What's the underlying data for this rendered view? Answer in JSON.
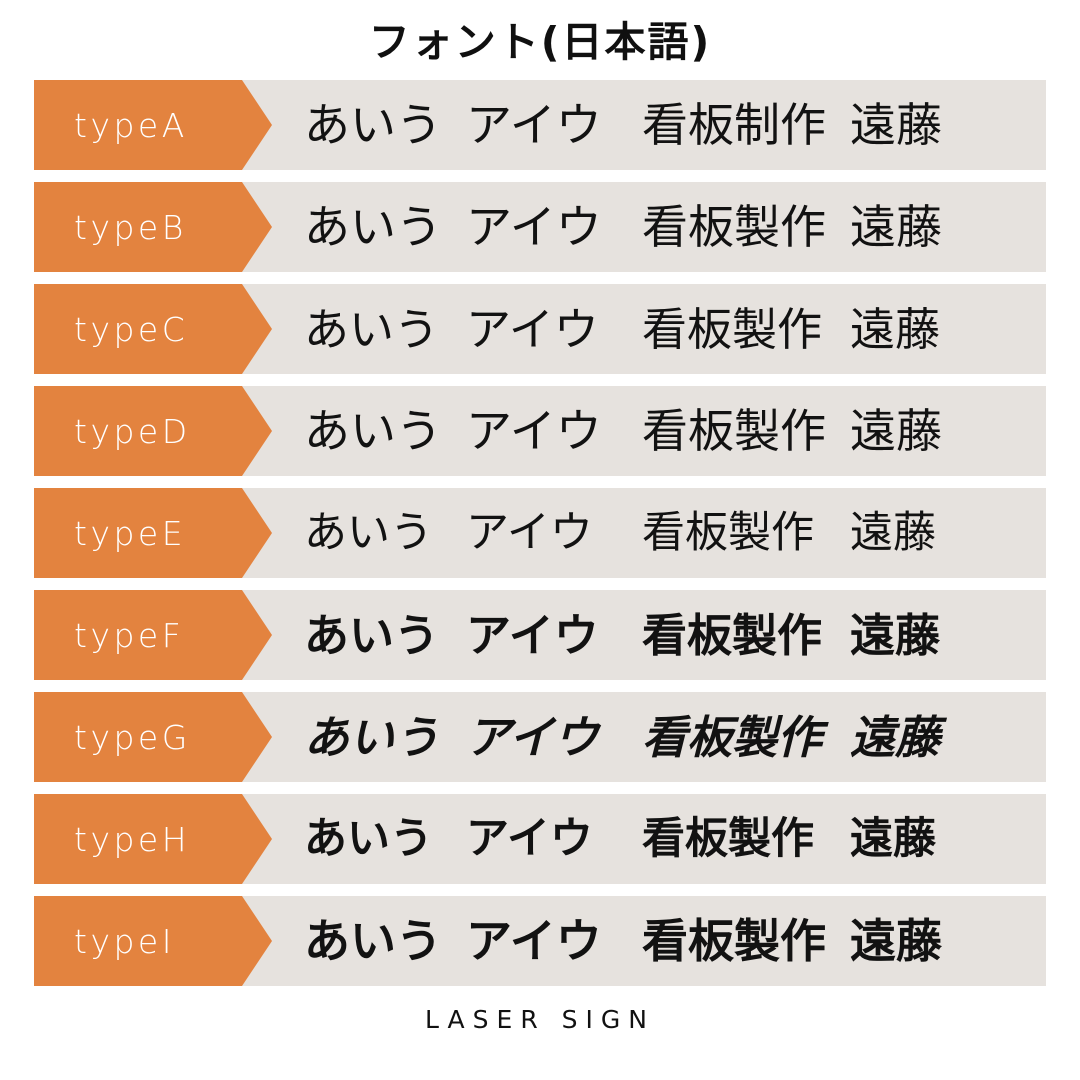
{
  "page": {
    "title": "フォント(日本語)",
    "footer": "LASER SIGN",
    "background_color": "#FFFFFF",
    "accent_color": "#E3833F",
    "row_background_color": "#E6E2DE",
    "text_color": "#121212",
    "tag_label_color": "#FFFFFF"
  },
  "columns": {
    "hiragana": "あいう",
    "katakana": "アイウ",
    "kanji": "看板製作",
    "name": "遠藤"
  },
  "rows": [
    {
      "label": "typeA",
      "hiragana": "あいう",
      "katakana": "アイウ",
      "kanji": "看板制作",
      "name": "遠藤"
    },
    {
      "label": "typeB",
      "hiragana": "あいう",
      "katakana": "アイウ",
      "kanji": "看板製作",
      "name": "遠藤"
    },
    {
      "label": "typeC",
      "hiragana": "あいう",
      "katakana": "アイウ",
      "kanji": "看板製作",
      "name": "遠藤"
    },
    {
      "label": "typeD",
      "hiragana": "あいう",
      "katakana": "アイウ",
      "kanji": "看板製作",
      "name": "遠藤"
    },
    {
      "label": "typeE",
      "hiragana": "あいう",
      "katakana": "アイウ",
      "kanji": "看板製作",
      "name": "遠藤"
    },
    {
      "label": "typeF",
      "hiragana": "あいう",
      "katakana": "アイウ",
      "kanji": "看板製作",
      "name": "遠藤"
    },
    {
      "label": "typeG",
      "hiragana": "あいう",
      "katakana": "アイウ",
      "kanji": "看板製作",
      "name": "遠藤"
    },
    {
      "label": "typeH",
      "hiragana": "あいう",
      "katakana": "アイウ",
      "kanji": "看板製作",
      "name": "遠藤"
    },
    {
      "label": "typeI",
      "hiragana": "あいう",
      "katakana": "アイウ",
      "kanji": "看板製作",
      "name": "遠藤"
    }
  ]
}
